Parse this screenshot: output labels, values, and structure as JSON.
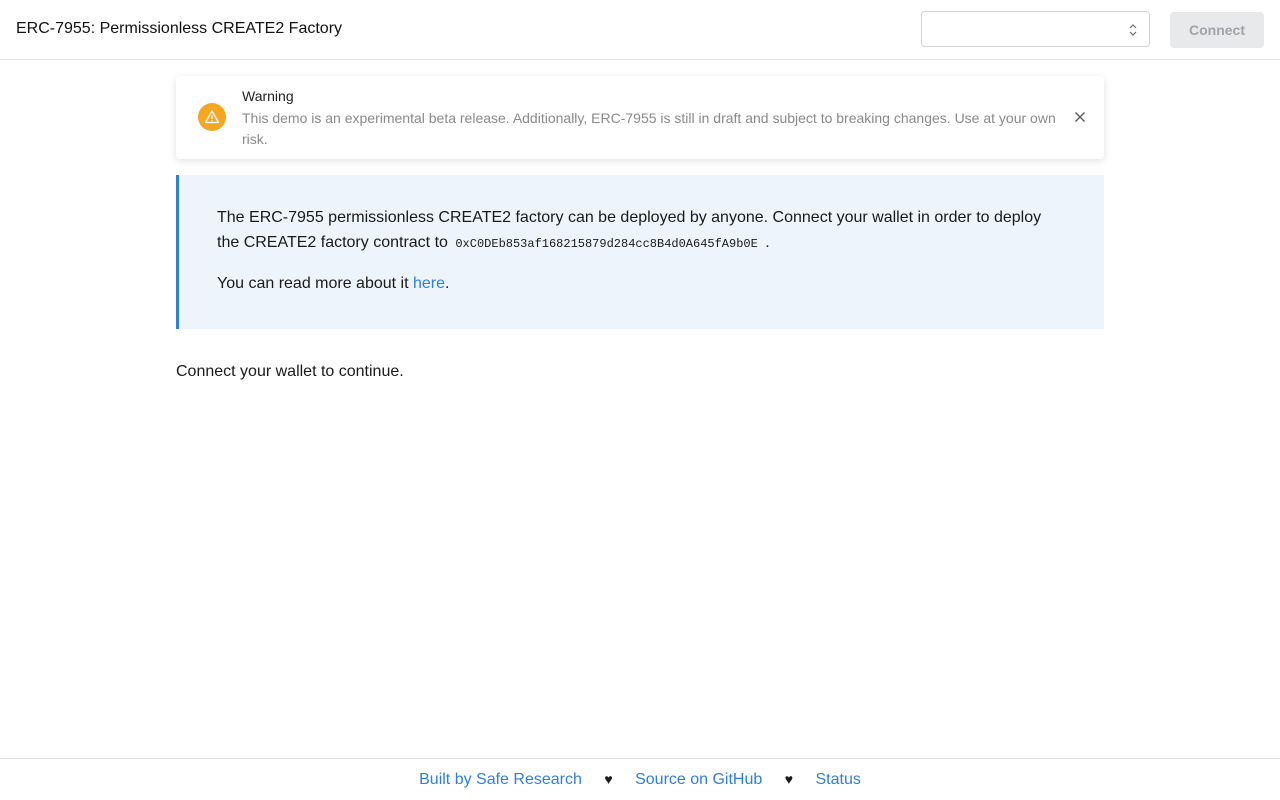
{
  "header": {
    "title": "ERC-7955: Permissionless CREATE2 Factory",
    "network_select_value": "",
    "connect_label": "Connect"
  },
  "warning": {
    "title": "Warning",
    "message": "This demo is an experimental beta release. Additionally, ERC-7955 is still in draft and subject to breaking changes. Use at your own risk.",
    "icon": "warning-triangle-icon",
    "icon_color": "#f5a623"
  },
  "info": {
    "p1_before": "The ERC-7955 permissionless CREATE2 factory can be deployed by anyone. Connect your wallet in order to deploy the CREATE2 factory contract to",
    "address": "0xC0DEb853af168215879d284cc8B4d0A645fA9b0E",
    "p1_after": ".",
    "p2_before": "You can read more about it",
    "p2_link": "here",
    "p2_after": ".",
    "accent_color": "#2f80d4"
  },
  "status_message": "Connect your wallet to continue.",
  "footer": {
    "links": [
      "Built by Safe Research",
      "Source on GitHub",
      "Status"
    ],
    "separator": "♥"
  }
}
